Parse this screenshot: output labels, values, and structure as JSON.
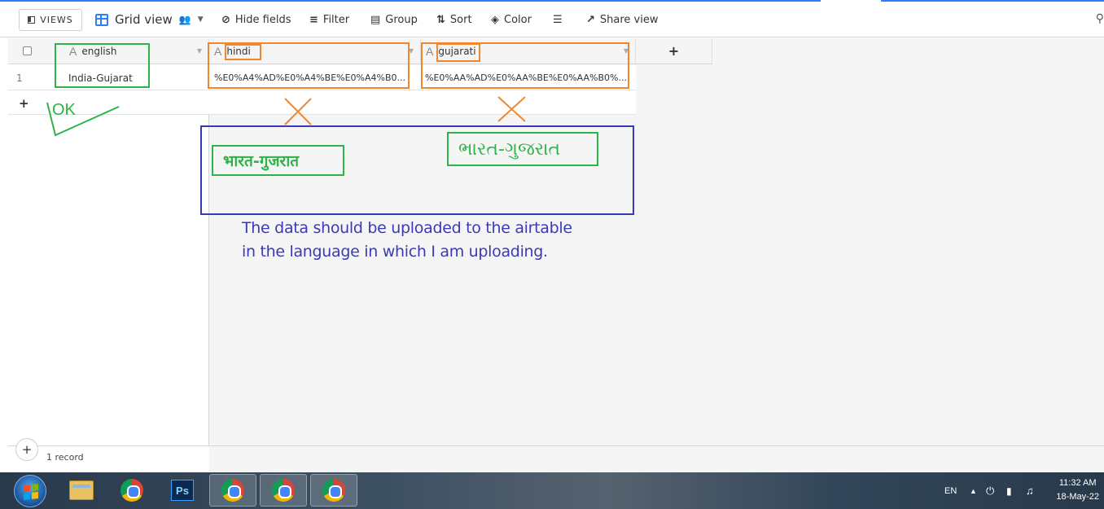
{
  "toolbar": {
    "views_label": "VIEWS",
    "view_name": "Grid view",
    "hide_fields": "Hide fields",
    "filter": "Filter",
    "group": "Group",
    "sort": "Sort",
    "color": "Color",
    "share_view": "Share view"
  },
  "grid": {
    "columns": [
      {
        "name": "english",
        "type_icon": "A"
      },
      {
        "name": "hindi",
        "type_icon": "A"
      },
      {
        "name": "gujarati",
        "type_icon": "A"
      }
    ],
    "add_column": "+",
    "rows": [
      {
        "number": "1",
        "english": "India-Gujarat",
        "hindi": "%E0%A4%AD%E0%A4%BE%E0%A4%B0...",
        "gujarati": "%E0%AA%AD%E0%AA%BE%E0%AA%B0%..."
      }
    ],
    "add_row": "+",
    "record_count": "1 record",
    "footer_add": "+"
  },
  "annotations": {
    "ok_text": "OK",
    "hindi_expected": "भारत-गुजरात",
    "gujarati_expected": "ભારત-ગુજરાત",
    "message_line1": "The data should be uploaded to the airtable",
    "message_line2": "in the language in which I am uploading.",
    "colors": {
      "green": "#2db34a",
      "orange": "#f0862e",
      "blue": "#3a3ab8"
    }
  },
  "taskbar": {
    "language": "EN",
    "time": "11:32 AM",
    "date": "18-May-22",
    "ps_label": "Ps"
  }
}
